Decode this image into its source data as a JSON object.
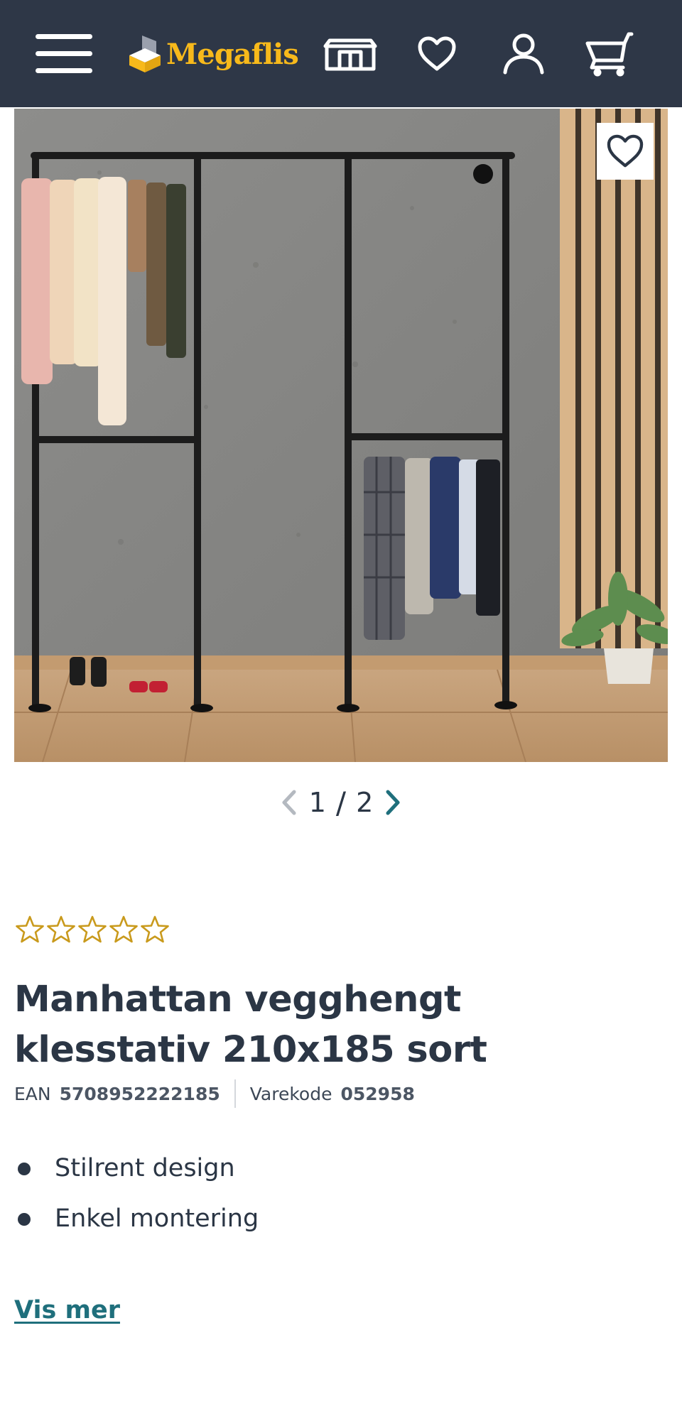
{
  "header": {
    "brand": "Megaflis",
    "icons": [
      "menu-icon",
      "store-icon",
      "heart-icon",
      "user-icon",
      "cart-icon"
    ]
  },
  "gallery": {
    "current": "1",
    "separator": "/",
    "total": "2",
    "favorite_icon": "heart-icon"
  },
  "rating": {
    "stars_filled": 0,
    "stars_total": 5,
    "color": "#c99a1c"
  },
  "product": {
    "title": "Manhattan vegghengt klesstativ 210x185 sort",
    "ean_label": "EAN",
    "ean_value": "5708952222185",
    "code_label": "Varekode",
    "code_value": "052958",
    "features": [
      "Stilrent design",
      "Enkel montering"
    ],
    "show_more": "Vis mer"
  },
  "colors": {
    "header_bg": "#2e3747",
    "brand": "#f7b91b",
    "link": "#1f6f7c",
    "text": "#2b3645"
  }
}
